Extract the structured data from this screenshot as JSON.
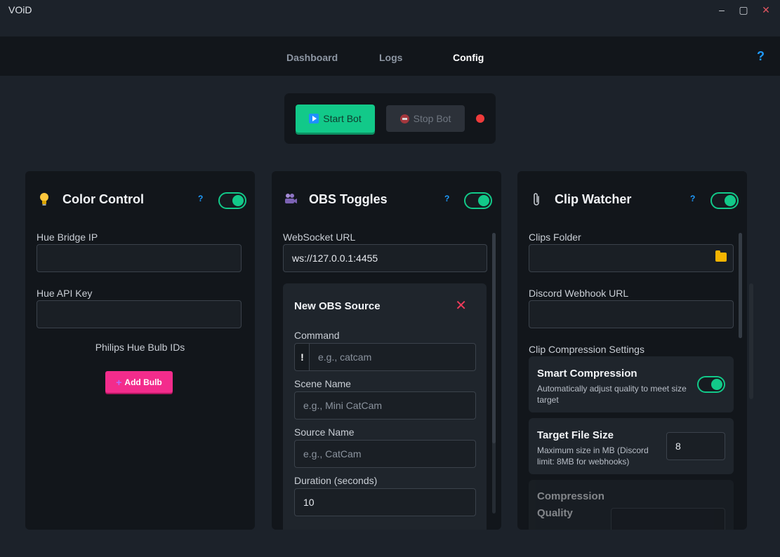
{
  "app": {
    "title": "VOiD"
  },
  "window_controls": {
    "minimize": "–",
    "maximize": "▢",
    "close": "✕"
  },
  "nav": {
    "tabs": [
      {
        "label": "Dashboard",
        "active": false
      },
      {
        "label": "Logs",
        "active": false
      },
      {
        "label": "Config",
        "active": true
      }
    ],
    "help": "?"
  },
  "bot_control": {
    "start_label": "Start Bot",
    "stop_label": "Stop Bot",
    "status_color": "#ef3b3b"
  },
  "panels": {
    "color_control": {
      "icon": "lightbulb-icon",
      "title": "Color Control",
      "help": "?",
      "enabled": true,
      "hue_bridge_ip_label": "Hue Bridge IP",
      "hue_bridge_ip_value": "",
      "hue_api_key_label": "Hue API Key",
      "hue_api_key_value": "",
      "bulb_ids_label": "Philips Hue Bulb IDs",
      "add_bulb_label": "Add Bulb"
    },
    "obs_toggles": {
      "icon": "camera-people-icon",
      "title": "OBS Toggles",
      "help": "?",
      "enabled": true,
      "websocket_label": "WebSocket URL",
      "websocket_value": "ws://127.0.0.1:4455",
      "source": {
        "title": "New OBS Source",
        "close": "✕",
        "command_label": "Command",
        "command_prefix": "!",
        "command_placeholder": "e.g., catcam",
        "scene_label": "Scene Name",
        "scene_placeholder": "e.g., Mini CatCam",
        "source_label": "Source Name",
        "source_placeholder": "e.g., CatCam",
        "duration_label": "Duration (seconds)",
        "duration_value": "10"
      }
    },
    "clip_watcher": {
      "icon": "paperclip-icon",
      "title": "Clip Watcher",
      "help": "?",
      "enabled": true,
      "clips_folder_label": "Clips Folder",
      "clips_folder_value": "",
      "webhook_label": "Discord Webhook URL",
      "webhook_value": "",
      "compression_section_label": "Clip Compression Settings",
      "smart_compression": {
        "title": "Smart Compression",
        "desc": "Automatically adjust quality to meet size target",
        "enabled": true
      },
      "target_size": {
        "title": "Target File Size",
        "desc": "Maximum size in MB (Discord limit: 8MB for webhooks)",
        "value": "8"
      },
      "quality": {
        "title": "Compression Quality"
      }
    }
  },
  "colors": {
    "accent_green": "#12c989",
    "accent_pink": "#f32c8c",
    "accent_blue": "#1e9bff",
    "status_red": "#ef3b3b"
  }
}
